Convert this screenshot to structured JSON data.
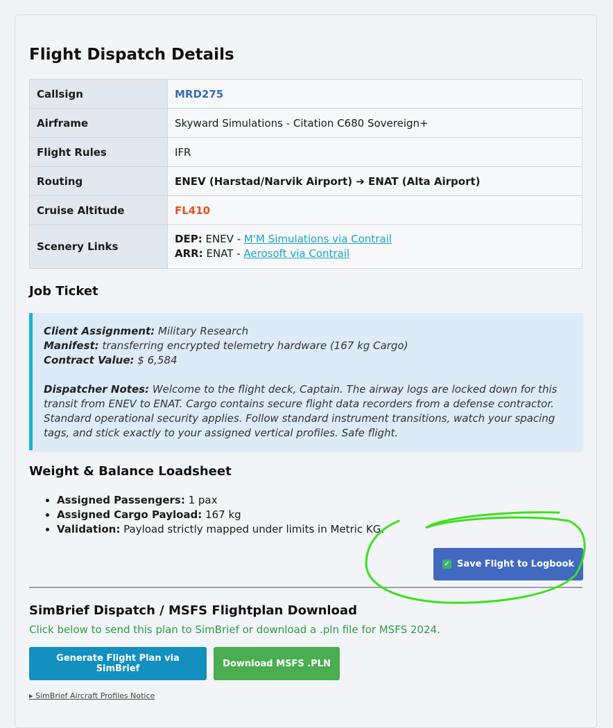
{
  "title": "Flight Dispatch Details",
  "details": {
    "callsign_label": "Callsign",
    "callsign": "MRD275",
    "airframe_label": "Airframe",
    "airframe": "Skyward Simulations - Citation C680 Sovereign+",
    "rules_label": "Flight Rules",
    "rules": "IFR",
    "routing_label": "Routing",
    "routing": "ENEV (Harstad/Narvik Airport) ➔ ENAT (Alta Airport)",
    "altitude_label": "Cruise Altitude",
    "altitude": "FL410",
    "scenery_label": "Scenery Links",
    "dep_label": "DEP:",
    "dep_code": "ENEV -",
    "dep_link": "M'M Simulations via Contrail",
    "arr_label": "ARR:",
    "arr_code": "ENAT -",
    "arr_link": "Aerosoft via Contrail"
  },
  "job_ticket": {
    "heading": "Job Ticket",
    "client_label": "Client Assignment:",
    "client": "Military Research",
    "manifest_label": "Manifest:",
    "manifest": "transferring encrypted telemetry hardware (167 kg Cargo)",
    "value_label": "Contract Value:",
    "value": "$ 6,584",
    "notes_label": "Dispatcher Notes:",
    "notes": "Welcome to the flight deck, Captain. The airway logs are locked down for this transit from ENEV to ENAT. Cargo contains secure flight data recorders from a defense contractor. Standard operational security applies. Follow standard instrument transitions, watch your spacing tags, and stick exactly to your assigned vertical profiles. Safe flight."
  },
  "loadsheet": {
    "heading": "Weight & Balance Loadsheet",
    "pax_label": "Assigned Passengers:",
    "pax": "1 pax",
    "cargo_label": "Assigned Cargo Payload:",
    "cargo": "167 kg",
    "validation_label": "Validation:",
    "validation": "Payload strictly mapped under limits in Metric KG."
  },
  "save_button": "Save Flight to Logbook",
  "simbrief": {
    "heading": "SimBrief Dispatch / MSFS Flightplan Download",
    "subtitle": "Click below to send this plan to SimBrief or download a .pln file for MSFS 2024.",
    "generate_button": "Generate Flight Plan via SimBrief",
    "download_button": "Download MSFS .PLN",
    "notice": "▸ SimBrief Aircraft Profiles Notice"
  },
  "colors": {
    "callsign": "#3a6ab0",
    "altitude": "#e8521f",
    "link": "#1ba3bf",
    "save_button": "#4169c0",
    "simbrief_button": "#138fc0",
    "download_button": "#4aad4f",
    "annotation": "#3ee01c"
  }
}
